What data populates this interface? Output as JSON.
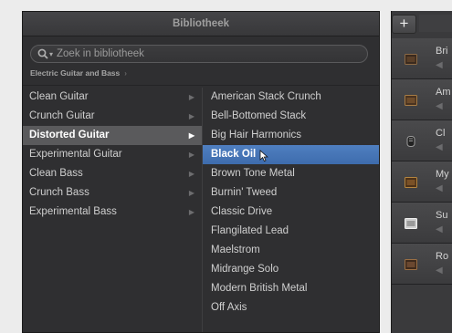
{
  "library": {
    "title": "Bibliotheek",
    "search": {
      "placeholder": "Zoek in bibliotheek",
      "value": ""
    },
    "breadcrumb": "Electric Guitar and Bass",
    "categories": [
      {
        "label": "Clean Guitar"
      },
      {
        "label": "Crunch Guitar"
      },
      {
        "label": "Distorted Guitar",
        "selected": true
      },
      {
        "label": "Experimental Guitar"
      },
      {
        "label": "Clean Bass"
      },
      {
        "label": "Crunch Bass"
      },
      {
        "label": "Experimental Bass"
      }
    ],
    "patches": [
      {
        "label": "American Stack Crunch"
      },
      {
        "label": "Bell-Bottomed Stack"
      },
      {
        "label": "Big Hair Harmonics"
      },
      {
        "label": "Black Oil",
        "selected": true
      },
      {
        "label": "Brown Tone Metal"
      },
      {
        "label": "Burnin' Tweed"
      },
      {
        "label": "Classic Drive"
      },
      {
        "label": "Flangilated Lead"
      },
      {
        "label": "Maelstrom"
      },
      {
        "label": "Midrange Solo"
      },
      {
        "label": "Modern British Metal"
      },
      {
        "label": "Off Axis"
      }
    ]
  },
  "tracks": {
    "add_label": "+",
    "items": [
      {
        "name": "Bri",
        "icon": "amp-icon"
      },
      {
        "name": "Am",
        "icon": "amp-icon"
      },
      {
        "name": "Cl",
        "icon": "microphone-icon"
      },
      {
        "name": "My",
        "icon": "amp-icon"
      },
      {
        "name": "Su",
        "icon": "amp-icon"
      },
      {
        "name": "Ro",
        "icon": "amp-icon"
      }
    ]
  },
  "colors": {
    "panel_bg": "#2f2f31",
    "category_selected": "#5a5a5c",
    "patch_selected": "#4574b6",
    "text": "#cfcfcf"
  }
}
